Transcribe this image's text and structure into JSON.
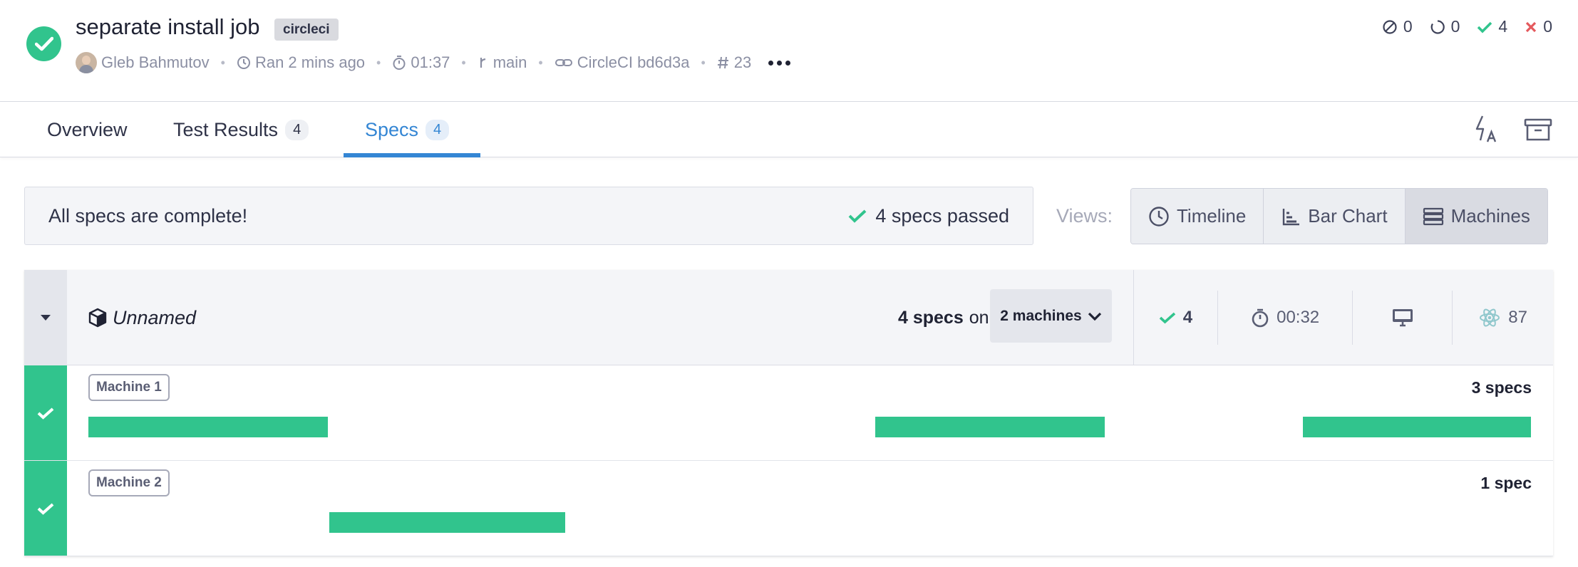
{
  "run": {
    "title": "separate install job",
    "tag": "circleci",
    "author": "Gleb Bahmutov",
    "ran": "Ran 2 mins ago",
    "duration": "01:37",
    "branch": "main",
    "commit": "CircleCI bd6d3a",
    "run_number": "23"
  },
  "counts": {
    "skipped": "0",
    "pending": "0",
    "passed": "4",
    "failed": "0"
  },
  "tabs": [
    {
      "label": "Overview",
      "badge": ""
    },
    {
      "label": "Test Results",
      "badge": "4"
    },
    {
      "label": "Specs",
      "badge": "4"
    }
  ],
  "banner": {
    "message": "All specs are complete!",
    "passed": "4 specs passed"
  },
  "views": {
    "label": "Views:",
    "options": [
      "Timeline",
      "Bar Chart",
      "Machines"
    ],
    "selected": "Machines"
  },
  "group": {
    "name": "Unnamed",
    "specs": "4 specs",
    "on": "on",
    "machines_button": "2 machines",
    "passed": "4",
    "duration": "00:32",
    "browser_version": "87"
  },
  "machines": [
    {
      "label": "Machine 1",
      "specs": "3 specs",
      "status": "passed"
    },
    {
      "label": "Machine 2",
      "specs": "1 spec",
      "status": "passed"
    }
  ],
  "colors": {
    "passed": "#31c48d",
    "accent": "#3486d4",
    "failed": "#e4595d"
  }
}
